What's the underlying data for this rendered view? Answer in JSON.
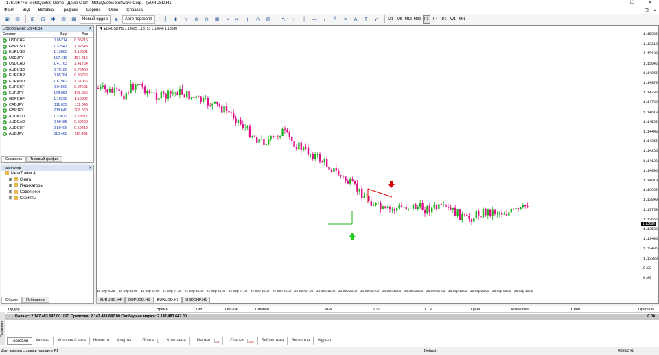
{
  "window": {
    "title": "176106776: MetaQuotes-Demo - Демо Счет - MetaQuotes Software Corp. - [EURUSD,H1]"
  },
  "menu": [
    "Файл",
    "Вид",
    "Вставка",
    "Графики",
    "Сервис",
    "Окно",
    "Справка"
  ],
  "toolbar": {
    "new_order": "Новый ордер",
    "autotrading": "Авто-торговля",
    "timeframes": [
      "M1",
      "M5",
      "M15",
      "M30",
      "H1",
      "H4",
      "D1",
      "W1",
      "MN"
    ]
  },
  "market_watch": {
    "title": "Обзор рынка: 23:48:34",
    "col_symbol": "Символ",
    "col_bid": "Бид",
    "col_ask": "Аск",
    "rows": [
      {
        "s": "USDCHF",
        "b": "0.85214",
        "a": "0.85215"
      },
      {
        "s": "GBPUSD",
        "b": "1.32547",
        "a": "1.32548"
      },
      {
        "s": "EURUSD",
        "b": "1.13680",
        "a": "1.13681"
      },
      {
        "s": "USDJPY",
        "b": "157.416",
        "a": "157.416"
      },
      {
        "s": "USDCAD",
        "b": "1.41763",
        "a": "1.41764"
      },
      {
        "s": "AUDUSD",
        "b": "0.70188",
        "a": "0.70460"
      },
      {
        "s": "EURGBP",
        "b": "0.85764",
        "a": "0.85766"
      },
      {
        "s": "EURAUD",
        "b": "1.61962",
        "a": "1.61966"
      },
      {
        "s": "EURCHF",
        "b": "0.94599",
        "a": "0.94601"
      },
      {
        "s": "EURJPY",
        "b": "178.953",
        "a": "178.956"
      },
      {
        "s": "GBPCHF",
        "b": "1.10298",
        "a": "1.10302"
      },
      {
        "s": "CADJPY",
        "b": "111.039",
        "a": "111.046"
      },
      {
        "s": "GBPJPY",
        "b": "208.649",
        "a": "208.660"
      },
      {
        "s": "AUDNZD",
        "b": "1.23813",
        "a": "1.23817"
      },
      {
        "s": "AUDCAD",
        "b": "0.99485",
        "a": "0.99490"
      },
      {
        "s": "AUDCHF",
        "b": "0.59406",
        "a": "0.59410"
      },
      {
        "s": "AUDJPY",
        "b": "110.488",
        "a": "110.491"
      }
    ],
    "tab_symbols": "Символы",
    "tab_ticks": "Тиковый график"
  },
  "navigator": {
    "title": "Навигатор",
    "root": "MetaTrader 4",
    "items": [
      "Счета",
      "Индикаторы",
      "Советники",
      "Скрипты"
    ],
    "tab_common": "Общие",
    "tab_fav": "Избранное"
  },
  "chart": {
    "info": "▼ EURUSD,H1 1.13685 1.13753 1.13646 1.13680",
    "current_price": "1.13680",
    "y_labels": [
      "1.15305",
      "1.15215",
      "1.15130",
      "1.15045",
      "1.14955",
      "1.14870",
      "1.14785",
      "1.14700",
      "1.14610",
      "1.14525",
      "1.14440",
      "1.14355",
      "1.14265",
      "1.14180",
      "1.14095",
      "1.14010",
      "1.13925",
      "1.13840",
      "1.13750",
      "1.13665",
      "1.13580",
      "1.13495",
      "1.13405",
      "1.13320",
      "0.00",
      "0.00"
    ],
    "x_labels": [
      "18 Sep 2026",
      "18 Sep 14:00",
      "18 Sep 22:00",
      "21 Sep 07:00",
      "21 Sep 15:00",
      "21 Sep 23:00",
      "22 Sep 07:00",
      "22 Sep 15:00",
      "22 Sep 23:00",
      "23 Sep 07:00",
      "23 Sep 15:00",
      "23 Sep 23:00",
      "24 Sep 07:00",
      "24 Sep 15:00",
      "24 Sep 23:00",
      "25 Sep 07:00",
      "25 Sep 15:00",
      "25 Sep 23:00",
      "28 Sep 08:00",
      "28 Sep 16:00"
    ],
    "tabs": [
      "EURUSD,H4",
      "GBPUSD,H1",
      "EURUSD,H1",
      "USDCHF,H1"
    ],
    "colors": {
      "bull": "#22b222",
      "bear": "#e0108a",
      "sell_arrow": "#d40000",
      "buy_arrow": "#22c822"
    }
  },
  "terminal": {
    "side_label": "Терминал",
    "columns": [
      "Ордер",
      "Время",
      "Тип",
      "Объем",
      "Символ",
      "Цена",
      "S / L",
      "T / P",
      "Цена",
      "Комиссия",
      "Своп",
      "Прибыль"
    ],
    "balance_line": "Баланс: 2 147 483 647.00 USD  Средства: 2 147 483 647.00  Свободная маржа: 2 147 483 647.00",
    "balance_value": "0.00",
    "tabs": [
      "Торговля",
      "Активы",
      "История Счета",
      "Новости",
      "Алерты",
      "Почта",
      "Компания",
      "Маркет",
      "Статьи",
      "Библиотека",
      "Эксперты",
      "Журнал"
    ],
    "badges": {
      "Почта": "7",
      "Маркет": "115",
      "Статьи": "1303"
    }
  },
  "status": {
    "help": "Для вызова справки нажмите F1",
    "profile": "Default",
    "traffic": "4959/3 kb"
  }
}
